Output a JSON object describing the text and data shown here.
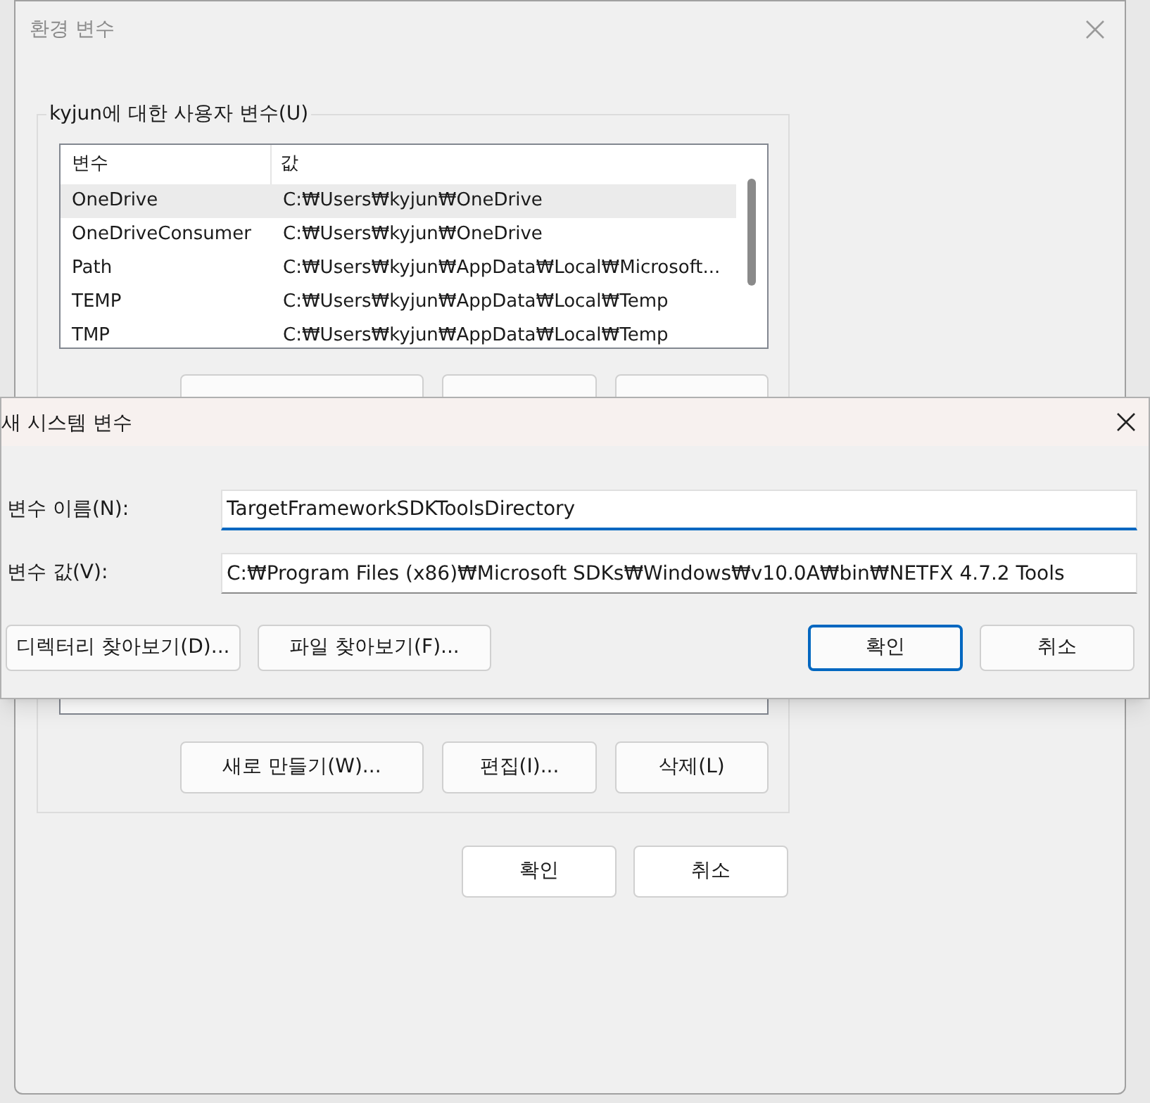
{
  "environment_dialog": {
    "title": "환경 변수",
    "user_variables": {
      "label": "kyjun에 대한 사용자 변수(U)",
      "columns": [
        "변수",
        "값"
      ],
      "rows": [
        {
          "name": "OneDrive",
          "value": "C:₩Users₩kyjun₩OneDrive",
          "selected": true
        },
        {
          "name": "OneDriveConsumer",
          "value": "C:₩Users₩kyjun₩OneDrive",
          "selected": false
        },
        {
          "name": "Path",
          "value": "C:₩Users₩kyjun₩AppData₩Local₩Microsoft...",
          "selected": false
        },
        {
          "name": "TEMP",
          "value": "C:₩Users₩kyjun₩AppData₩Local₩Temp",
          "selected": false
        },
        {
          "name": "TMP",
          "value": "C:₩Users₩kyjun₩AppData₩Local₩Temp",
          "selected": false
        }
      ]
    },
    "system_buttons": [
      "새로 만들기(W)...",
      "편집(I)...",
      "삭제(L)"
    ],
    "buttons": [
      "확인",
      "취소"
    ]
  },
  "new_variable_dialog": {
    "title": "새 시스템 변수",
    "fields": [
      {
        "label": "변수 이름(N):",
        "value": "TargetFrameworkSDKToolsDirectory",
        "focused": true
      },
      {
        "label": "변수 값(V):",
        "value": "C:₩Program Files (x86)₩Microsoft SDKs₩Windows₩v10.0A₩bin₩NETFX 4.7.2 Tools",
        "focused": false
      }
    ],
    "browse_buttons": [
      "디렉터리 찾아보기(D)...",
      "파일 찾아보기(F)..."
    ],
    "buttons": [
      {
        "label": "확인",
        "default": true
      },
      {
        "label": "취소",
        "default": false
      }
    ]
  }
}
